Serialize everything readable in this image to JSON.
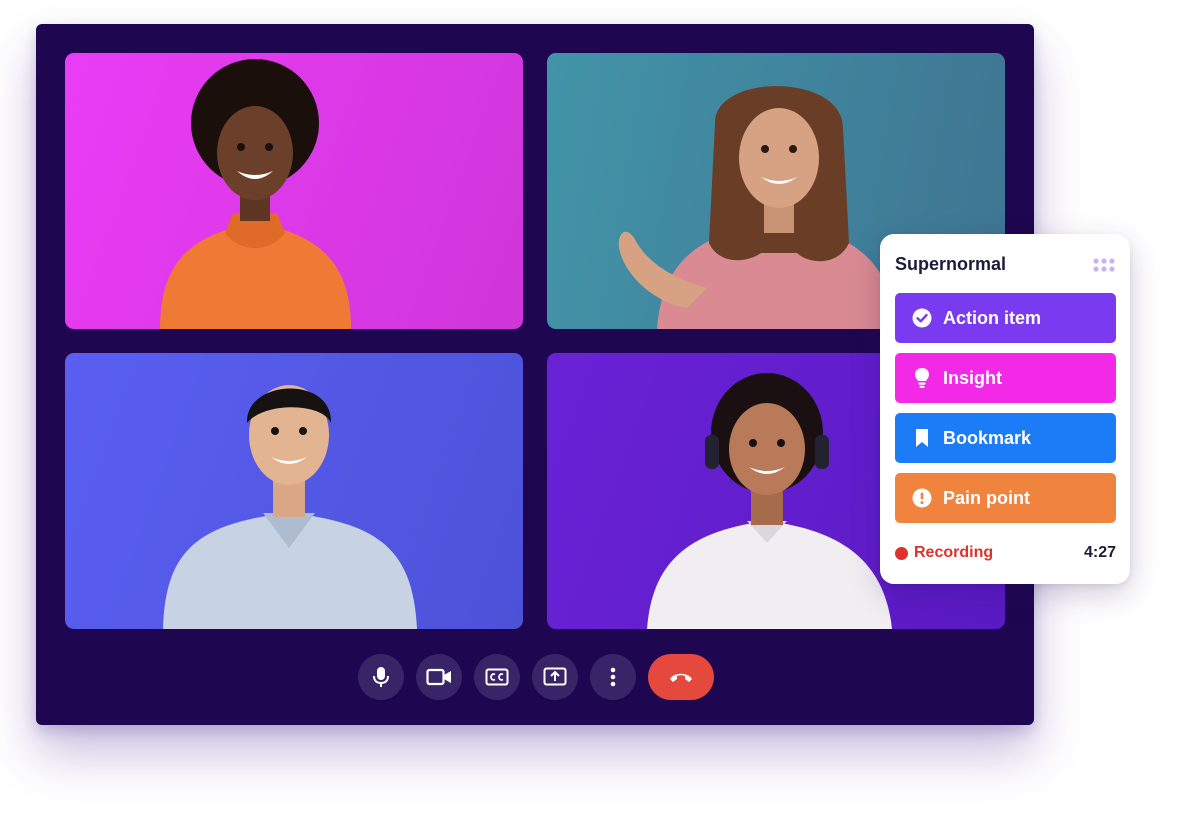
{
  "participants": [
    {
      "name": "participant-1",
      "bg": "#e43ef2",
      "shirt": "#f07a35",
      "skin": "#6b3f2a",
      "hair": "#1a0f0a"
    },
    {
      "name": "participant-2",
      "bg": "#4294a8",
      "shirt": "#d98a92",
      "skin": "#d7a284",
      "hair": "#6a3d26"
    },
    {
      "name": "participant-3",
      "bg": "#5a5ff1",
      "shirt": "#c7d3e2",
      "skin": "#e3b491",
      "hair": "#161212"
    },
    {
      "name": "participant-4",
      "bg": "#6a22d6",
      "shirt": "#f1eef2",
      "skin": "#b87a58",
      "hair": "#1a1012"
    }
  ],
  "controls": [
    {
      "name": "microphone-button",
      "icon": "microphone-icon"
    },
    {
      "name": "camera-button",
      "icon": "video-camera-icon"
    },
    {
      "name": "captions-button",
      "icon": "closed-captions-icon"
    },
    {
      "name": "share-screen-button",
      "icon": "share-screen-icon"
    },
    {
      "name": "more-options-button",
      "icon": "more-vertical-icon"
    },
    {
      "name": "end-call-button",
      "icon": "hang-up-icon",
      "color": "#e5483c"
    }
  ],
  "panel": {
    "title": "Supernormal",
    "tags": [
      {
        "label": "Action item",
        "icon": "check-circle-icon",
        "color": "#7a3af0"
      },
      {
        "label": "Insight",
        "icon": "lightbulb-icon",
        "color": "#f22ae7"
      },
      {
        "label": "Bookmark",
        "icon": "bookmark-icon",
        "color": "#1c7cf8"
      },
      {
        "label": "Pain point",
        "icon": "exclamation-circle-icon",
        "color": "#f0843f"
      }
    ],
    "recording": {
      "label": "Recording",
      "time": "4:27",
      "color": "#e0322d"
    }
  },
  "colors": {
    "window": "#1f0650",
    "control_bg": "#3a2468"
  }
}
